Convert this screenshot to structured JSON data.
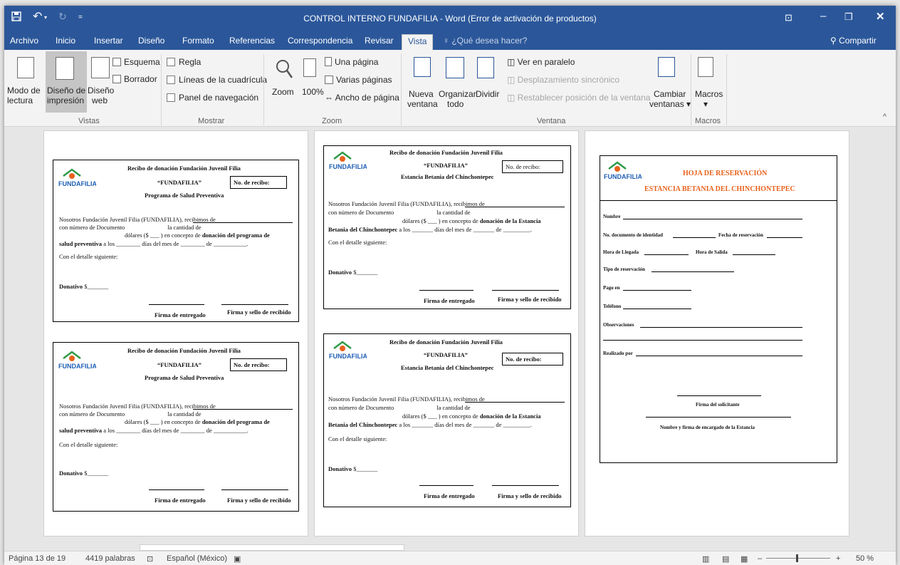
{
  "titlebar": {
    "title": "CONTROL INTERNO FUNDAFILIA - Word (Error de activación de productos)",
    "share": "Compartir",
    "save_icon": "save-icon",
    "undo_icon": "undo-icon",
    "redo_icon": "redo-icon"
  },
  "tabs": [
    "Archivo",
    "Inicio",
    "Insertar",
    "Diseño",
    "Formato",
    "Referencias",
    "Correspondencia",
    "Revisar",
    "Vista"
  ],
  "tell_me": "¿Qué desea hacer?",
  "ribbon": {
    "read_mode_1": "Modo de",
    "read_mode_2": "lectura",
    "print_layout_1": "Diseño de",
    "print_layout_2": "impresión",
    "web_layout_1": "Diseño",
    "web_layout_2": "web",
    "outline": "Esquema",
    "draft": "Borrador",
    "group_views": "Vistas",
    "ruler": "Regla",
    "gridlines": "Líneas de la cuadrícula",
    "nav_pane": "Panel de navegación",
    "group_show": "Mostrar",
    "zoom": "Zoom",
    "zoom100": "100%",
    "one_page": "Una página",
    "multi_pages": "Varias páginas",
    "page_width": "Ancho de página",
    "group_zoom": "Zoom",
    "new_window_1": "Nueva",
    "new_window_2": "ventana",
    "arrange_1": "Organizar",
    "arrange_2": "todo",
    "split": "Dividir",
    "side_by_side": "Ver en paralelo",
    "sync_scroll": "Desplazamiento sincrónico",
    "reset_pos": "Restablecer posición de la ventana",
    "group_window": "Ventana",
    "switch_1": "Cambiar",
    "switch_2": "ventanas",
    "macros": "Macros",
    "group_macros": "Macros"
  },
  "receipt": {
    "title": "Recibo de donación Fundación Juvenil Filia",
    "name": "“FUNDAFILIA”",
    "prog": "Programa de Salud Preventiva",
    "estancia": "Estancia Betania del Chinchontepec",
    "no_recibo": "No. de recibo:",
    "l1": "Nosotros Fundación Juvenil Filia (FUNDAFILIA), recibimos de",
    "l2a": "con número de Documento",
    "l2b": "la cantidad de",
    "l3a": "dólares ($",
    "l3b": ") en concepto de",
    "l3c_prog": "donación del programa de",
    "l4_prog": "salud preventiva",
    "l3c_est": "donación de la Estancia",
    "l4_est": "Betania del Chinchontepec",
    "l4b": "a los",
    "l4c": "días del mes de",
    "l4d": "de",
    "detalle": "Con el detalle siguiente:",
    "donativo": "Donativo",
    "dollar": "$",
    "firma1": "Firma de entregado",
    "firma2": "Firma y sello de recibido"
  },
  "reserva": {
    "title1": "HOJA DE RESERVACIÓN",
    "title2": "ESTANCIA BETANIA DEL CHINCHONTEPEC",
    "nombre": "Nombre",
    "doc": "No. documento de identidad",
    "fecha": "Fecha de reservación",
    "llegada": "Hora de Llegada",
    "salida": "Hora de Salida",
    "tipo": "Tipo de reservación",
    "pago": "Pago en",
    "tel": "Teléfono",
    "obs": "Observaciones",
    "realizado": "Realizado por",
    "firma_sol": "Firma del solicitante",
    "firma_enc": "Nombre y firma de encargado de la Estancia"
  },
  "logo_text": "FUNDAFILIA",
  "status": {
    "page": "Página 13 de 19",
    "words": "4419 palabras",
    "lang": "Español (México)",
    "zoom": "50 %"
  },
  "colors": {
    "accent": "#2b579a",
    "orange": "#e8621c"
  }
}
